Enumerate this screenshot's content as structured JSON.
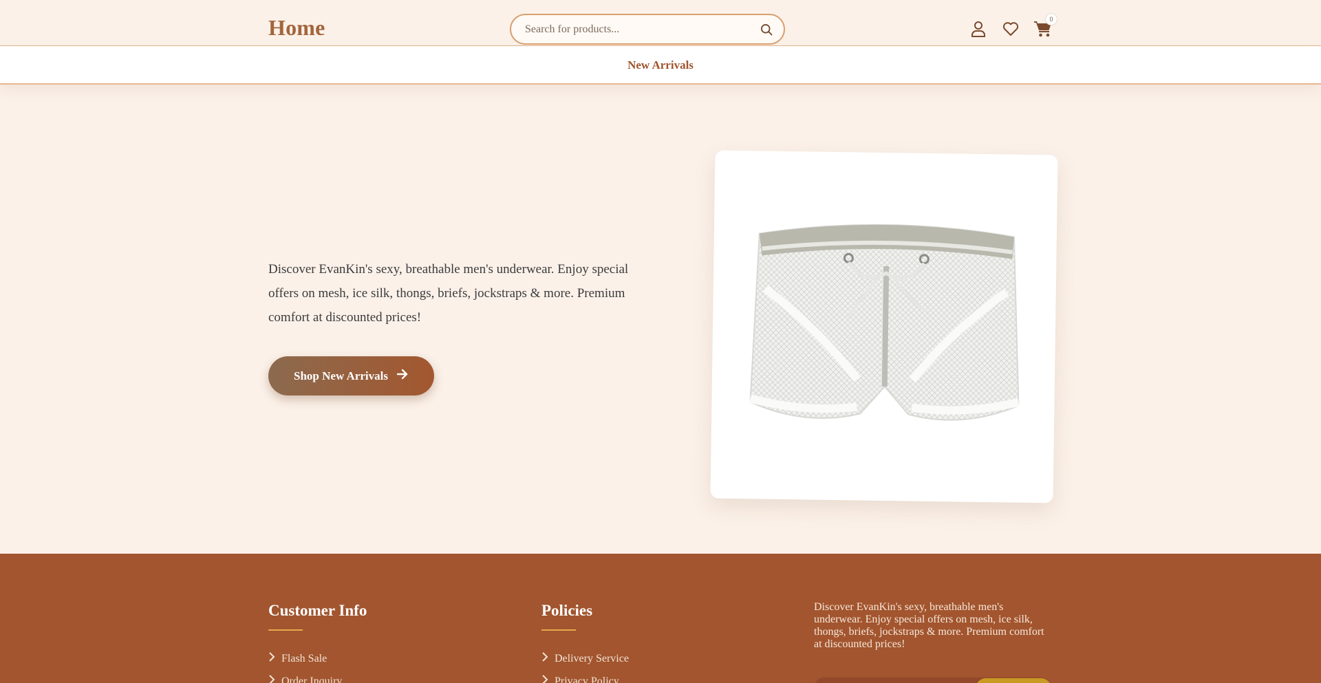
{
  "header": {
    "logo_text": "Home",
    "search_placeholder": "Search for products...",
    "cart_count": "0",
    "icons": [
      "user-icon",
      "heart-icon",
      "cart-icon",
      "search-icon"
    ]
  },
  "nav": {
    "items": [
      {
        "label": "New Arrivals"
      }
    ]
  },
  "hero": {
    "description": "Discover EvanKin's sexy, breathable men's underwear. Enjoy special offers on mesh, ice silk, thongs, briefs, jockstraps & more. Premium comfort at discounted prices!",
    "cta_label": "Shop New Arrivals"
  },
  "footer": {
    "customer_info": {
      "title": "Customer Info",
      "links": [
        "Flash Sale",
        "Order Inquiry"
      ]
    },
    "policies": {
      "title": "Policies",
      "links": [
        "Delivery Service",
        "Privacy Policy"
      ]
    },
    "about": "Discover EvanKin's sexy, breathable men's underwear. Enjoy special offers on mesh, ice silk, thongs, briefs, jockstraps & more. Premium comfort at discounted prices!"
  },
  "colors": {
    "background": "#fbf1e9",
    "accent": "#a0532c",
    "footer": "#a2552e",
    "footer_rule": "#e8a94d"
  }
}
